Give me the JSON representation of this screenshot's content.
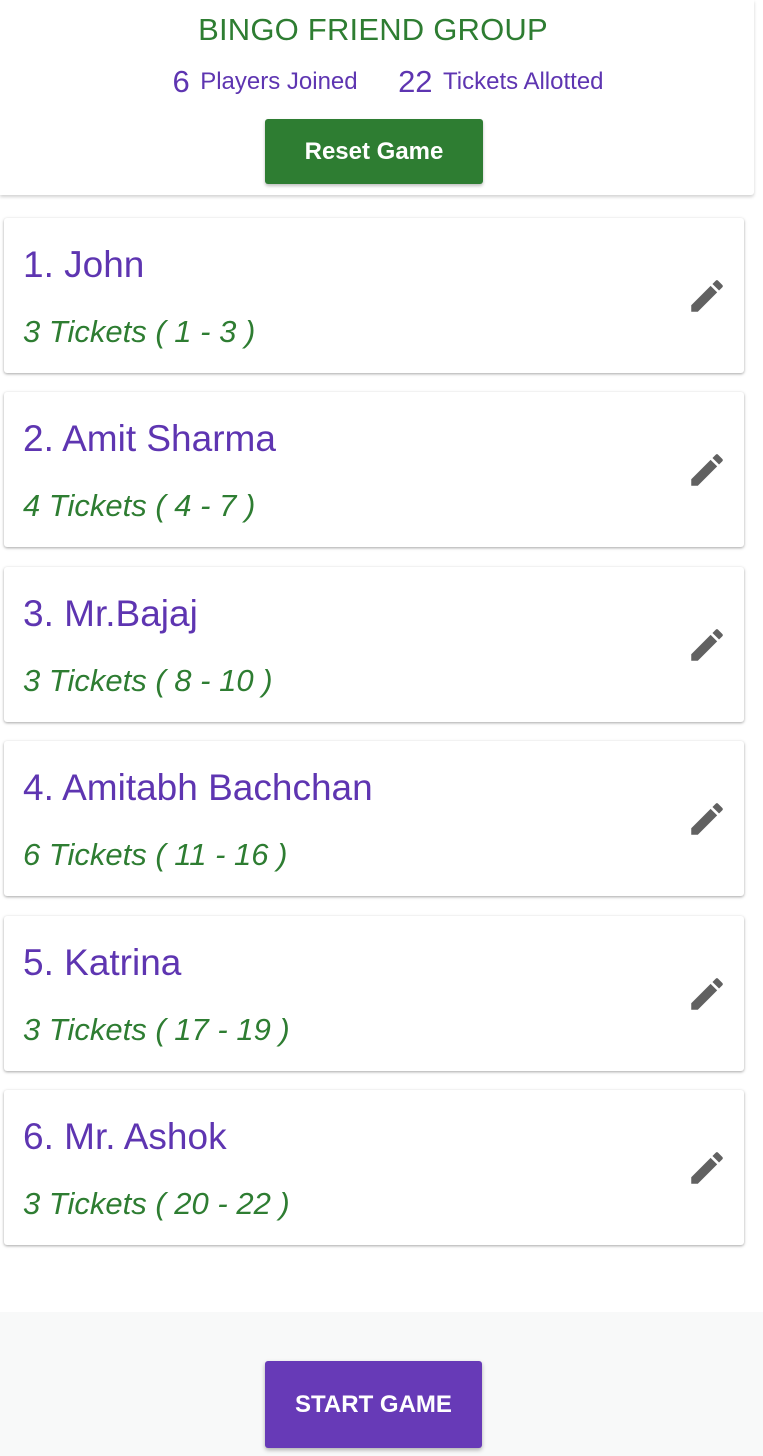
{
  "header": {
    "title": "BINGO FRIEND GROUP",
    "players_count": "6",
    "players_label": "Players Joined",
    "tickets_count": "22",
    "tickets_label": "Tickets Allotted",
    "reset_label": "Reset Game"
  },
  "players": [
    {
      "name": "1. John",
      "tickets": "3 Tickets ( 1 - 3 )",
      "icon": "pencil-edit-icon"
    },
    {
      "name": "2. Amit Sharma",
      "tickets": "4 Tickets ( 4 - 7 )",
      "icon": "pencil-edit-icon"
    },
    {
      "name": "3. Mr.Bajaj",
      "tickets": "3 Tickets ( 8 - 10 )",
      "icon": "pencil-edit-icon"
    },
    {
      "name": "4. Amitabh Bachchan",
      "tickets": "6 Tickets ( 11 - 16 )",
      "icon": "pencil-edit-icon"
    },
    {
      "name": "5. Katrina",
      "tickets": "3 Tickets ( 17 - 19 )",
      "icon": "pencil-edit-icon"
    },
    {
      "name": "6. Mr. Ashok",
      "tickets": "3 Tickets ( 20 - 22 )",
      "icon": "pencil-edit-icon"
    }
  ],
  "footer": {
    "start_label": "START GAME"
  },
  "colors": {
    "green": "#2e7d32",
    "purple": "#5e35b1",
    "button_purple": "#673ab7",
    "icon_gray": "#616161"
  }
}
